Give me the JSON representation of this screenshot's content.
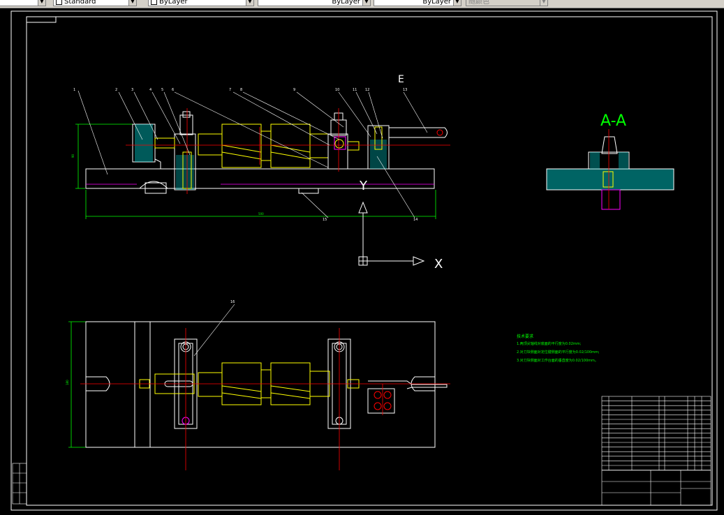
{
  "toolbar": {
    "text_style": "Standard",
    "layer": "ByLayer",
    "linetype": "ByLayer",
    "lineweight": "ByLayer",
    "plot_style": "随颜色"
  },
  "drawing": {
    "section_label": "A-A",
    "ucs_x_label": "X",
    "ucs_y_label": "Y",
    "section_marker": "E",
    "balloons": [
      "1",
      "2",
      "3",
      "4",
      "5",
      "6",
      "7",
      "8",
      "9",
      "10",
      "11",
      "12",
      "13",
      "14",
      "15",
      "16"
    ],
    "tech_requirements": {
      "title": "技术要求",
      "items": [
        "1.两顶尖轴线对底面的平行度为0.02mm;",
        "2.对刀块侧面对定位键侧面的平行度为0.02/100mm;",
        "3.对刀块侧面对工作台面的垂直度为0.02/100mm。"
      ]
    },
    "colors": {
      "outline": "#ffffff",
      "part_yellow": "#ffff00",
      "centerline_red": "#ff0000",
      "hatch_cyan": "#00ffff",
      "dimension_green": "#00ff00",
      "magenta": "#ff00ff"
    }
  }
}
